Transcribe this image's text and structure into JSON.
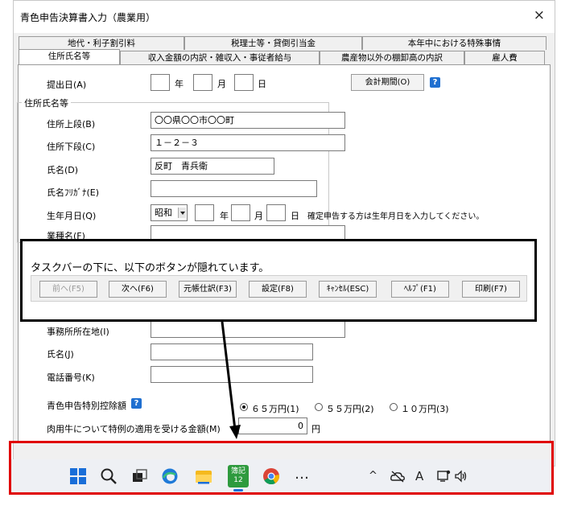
{
  "window": {
    "title": "青色申告決算書入力（農業用）",
    "close_glyph": "×"
  },
  "tabs_row1": [
    "地代・利子割引料",
    "税理士等・貸倒引当金",
    "本年中における特殊事情"
  ],
  "tabs_row2": [
    "住所氏名等",
    "収入金額の内訳・雑収入・事従者給与",
    "農産物以外の棚卸高の内訳",
    "雇人費"
  ],
  "form": {
    "submit_date_label": "提出日(A)",
    "year_unit": "年",
    "month_unit": "月",
    "day_unit": "日",
    "accounting_period_button": "会計期間(O)",
    "help_glyph": "?",
    "address_group_label": "住所氏名等",
    "address_upper_label": "住所上段(B)",
    "address_upper_value": "〇〇県〇〇市〇〇町",
    "address_lower_label": "住所下段(C)",
    "address_lower_value": "１－２－３",
    "name_label": "氏名(D)",
    "name_value": "反町　青兵衛",
    "name_kana_label": "氏名ﾌﾘｶﾞﾅ(E)",
    "birthdate_label": "生年月日(Q)",
    "era_value": "昭和",
    "birthdate_note": "確定申告する方は生年月日を入力してください。",
    "business_label": "業種名(F)",
    "office_address_label": "事務所所在地(I)",
    "office_name_label": "氏名(J)",
    "office_phone_label": "電話番号(K)",
    "deduction_label": "青色申告特別控除額",
    "deduction_options": [
      "６５万円(1)",
      "５５万円(2)",
      "１０万円(3)"
    ],
    "beef_label": "肉用牛について特例の適用を受ける金額(M)",
    "beef_value": "0",
    "beef_unit": "円"
  },
  "callout": {
    "text": "タスクバーの下に、以下のボタンが隠れています。",
    "buttons": [
      "前へ(F5)",
      "次へ(F6)",
      "元帳仕訳(F3)",
      "設定(F8)",
      "ｷｬﾝｾﾙ(ESC)",
      "ﾍﾙﾌﾟ(F1)",
      "印刷(F7)"
    ]
  },
  "taskbar": {
    "app_badge_line1": "簿記",
    "app_badge_line2": "12",
    "more_glyph": "…",
    "chevron_glyph": "^",
    "ime_glyph": "A",
    "icons": [
      "windows-start-icon",
      "search-icon",
      "task-view-icon",
      "edge-icon",
      "file-explorer-icon",
      "bookkeeping-app-icon",
      "chrome-icon",
      "more-icon",
      "chevron-up-icon",
      "cloud-offline-icon",
      "ime-icon",
      "network-icon",
      "speaker-icon"
    ]
  },
  "colors": {
    "highlight_red": "#e00000",
    "help_blue": "#1f6fd0",
    "app_green": "#2e9a3e"
  }
}
